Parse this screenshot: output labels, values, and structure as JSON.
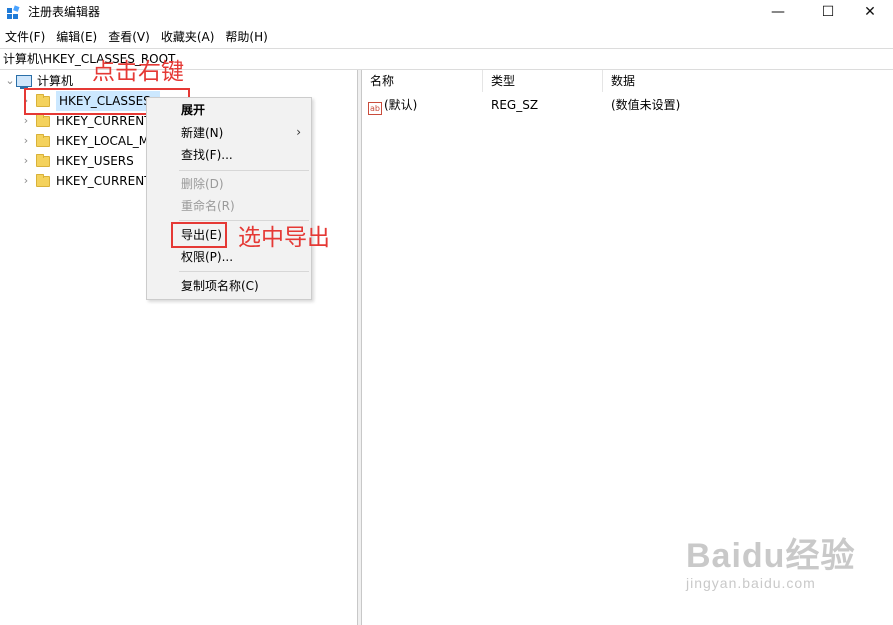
{
  "window": {
    "title": "注册表编辑器",
    "controls": {
      "minimize": "—",
      "maximize": "☐",
      "close": "✕"
    }
  },
  "menu": [
    "文件(F)",
    "编辑(E)",
    "查看(V)",
    "收藏夹(A)",
    "帮助(H)"
  ],
  "address": "计算机\\HKEY_CLASSES_ROOT",
  "tree": {
    "root": "计算机",
    "items": [
      "HKEY_CLASSES_",
      "HKEY_CURRENT",
      "HKEY_LOCAL_M",
      "HKEY_USERS",
      "HKEY_CURRENT"
    ]
  },
  "context_menu": {
    "expand": "展开",
    "new": "新建(N)",
    "find": "查找(F)...",
    "delete": "删除(D)",
    "rename": "重命名(R)",
    "export": "导出(E)",
    "permissions": "权限(P)...",
    "copy_key_name": "复制项名称(C)"
  },
  "annotations": {
    "right_click": "点击右键",
    "select_export": "选中导出"
  },
  "list": {
    "headers": [
      "名称",
      "类型",
      "数据"
    ],
    "rows": [
      {
        "name": "(默认)",
        "type": "REG_SZ",
        "data": "(数值未设置)",
        "icon": "ab"
      }
    ]
  },
  "watermark": {
    "main": "Baidu经验",
    "sub": "jingyan.baidu.com"
  },
  "colors": {
    "annotation_red": "#e53935",
    "selection_blue": "#cce8ff",
    "folder_yellow": "#f4d25d"
  }
}
